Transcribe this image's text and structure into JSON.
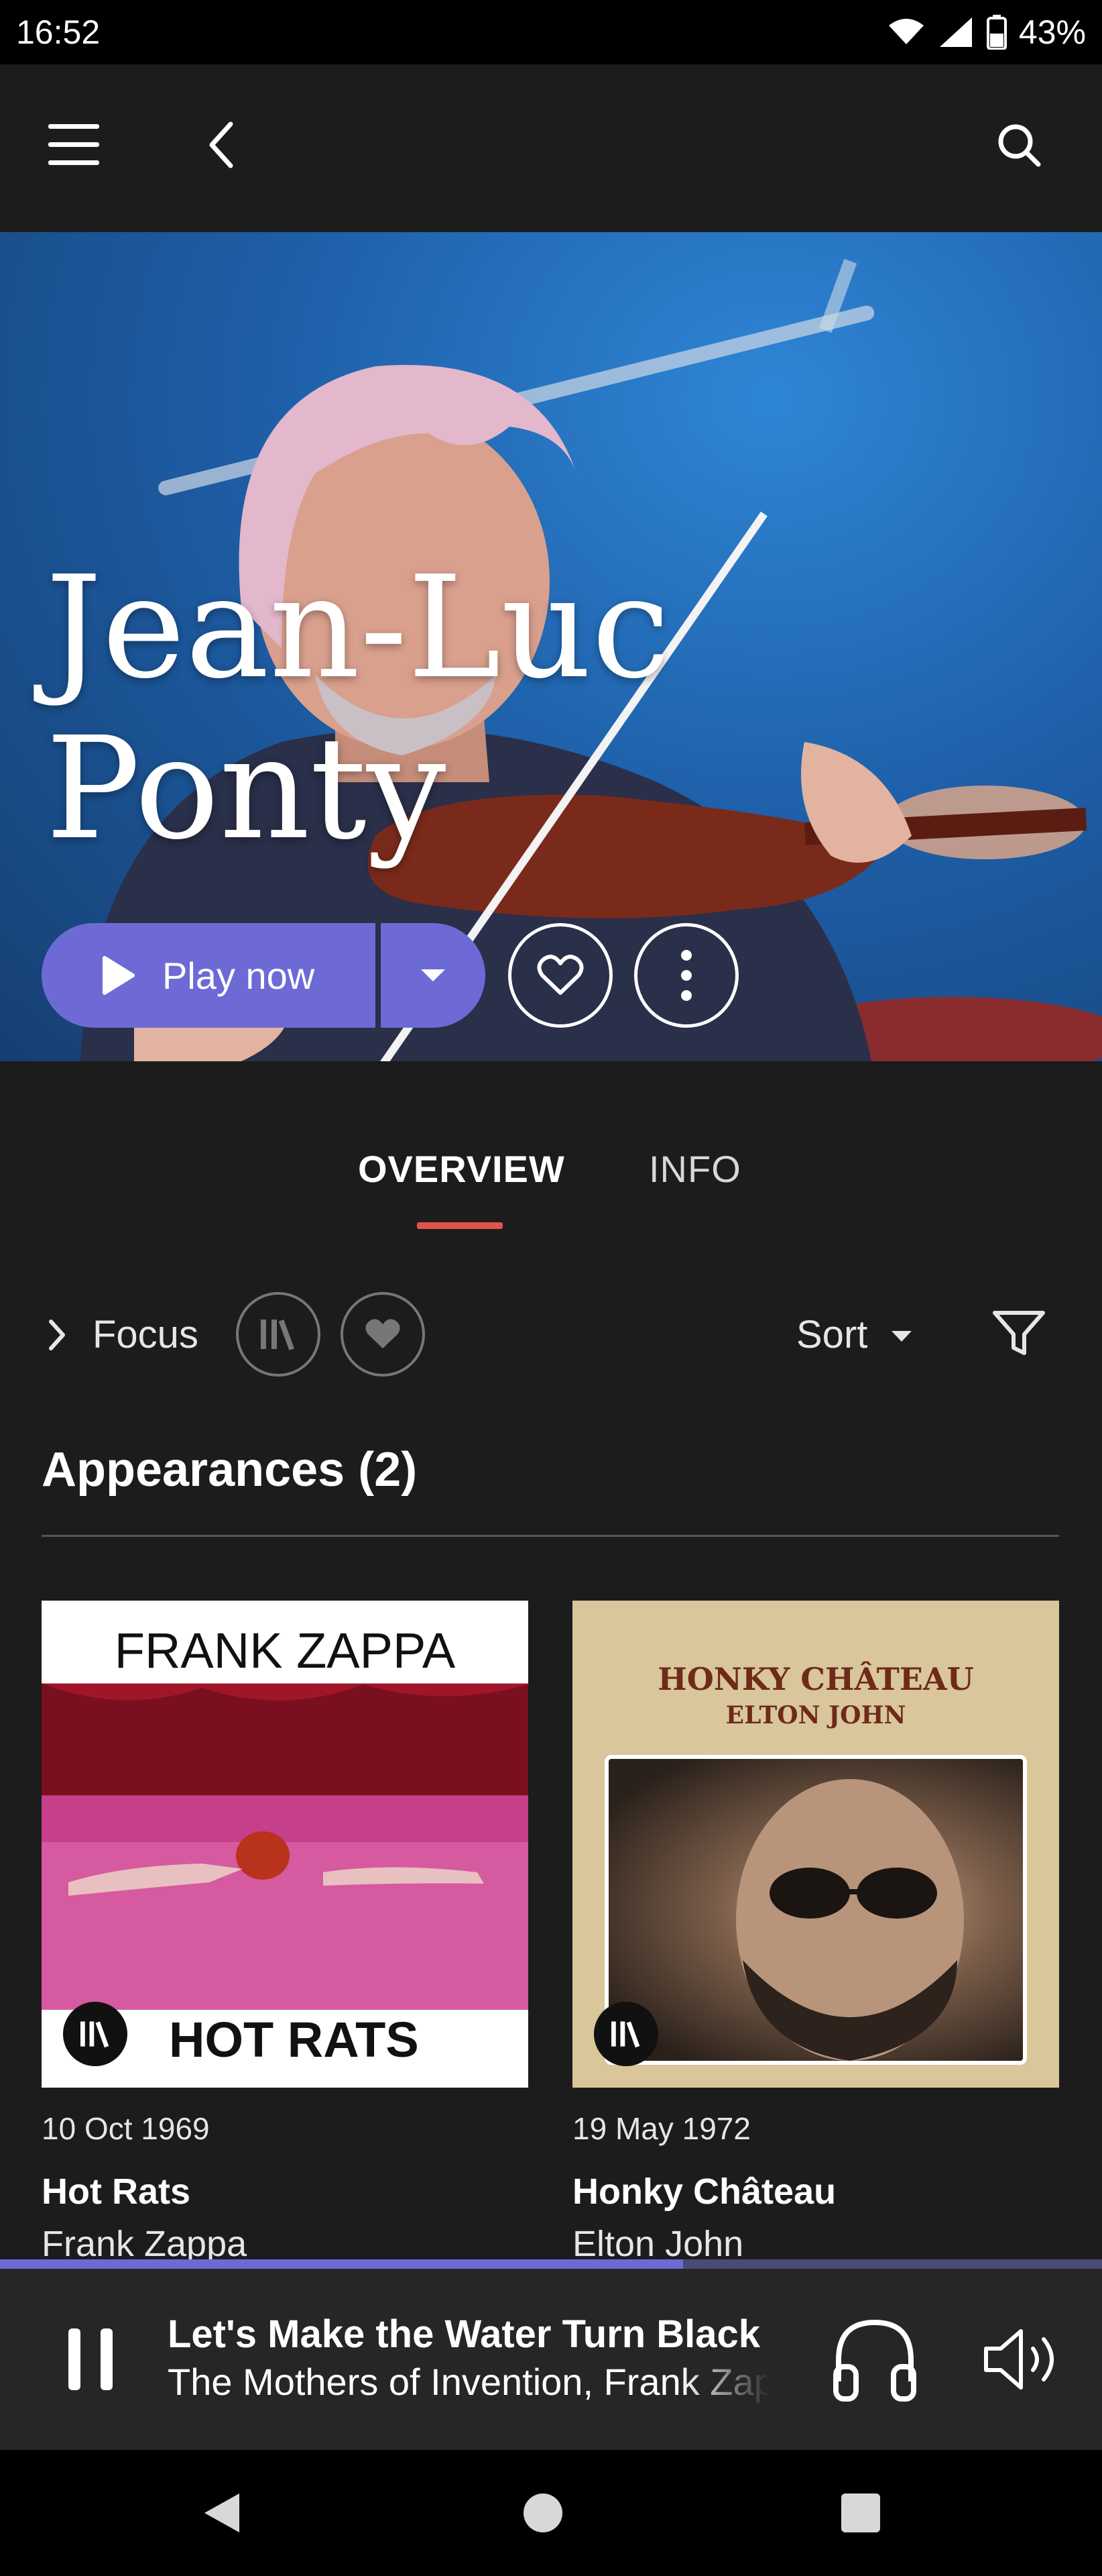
{
  "status_bar": {
    "time": "16:52",
    "battery": "43%",
    "icons": [
      "wifi-icon",
      "signal-icon",
      "battery-icon"
    ]
  },
  "app_bar": {
    "icons": [
      "menu-icon",
      "back-icon",
      "search-icon"
    ]
  },
  "artist": {
    "name": "Jean-Luc\nPonty"
  },
  "hero_actions": {
    "play_label": "Play now",
    "icons": [
      "play-icon",
      "dropdown-icon",
      "heart-icon",
      "more-icon"
    ]
  },
  "tabs": [
    {
      "label": "OVERVIEW",
      "active": true
    },
    {
      "label": "INFO",
      "active": false
    }
  ],
  "filters": {
    "focus_label": "Focus",
    "sort_label": "Sort",
    "icons": [
      "chevron-right-icon",
      "library-icon",
      "heart-icon",
      "caret-down-icon",
      "filter-icon"
    ]
  },
  "section": {
    "title": "Appearances (2)"
  },
  "albums": [
    {
      "cover_top_text": "FRANK ZAPPA",
      "cover_bottom_text": "HOT RATS",
      "date": "10 Oct 1969",
      "title": "Hot Rats",
      "artist": "Frank Zappa"
    },
    {
      "cover_title_line1": "HONKY CHÂTEAU",
      "cover_title_line2": "ELTON JOHN",
      "date": "19 May 1972",
      "title": "Honky Château",
      "artist": "Elton John"
    }
  ],
  "player": {
    "track_title": "Let's Make the Water Turn Black",
    "track_artists": "The Mothers of Invention, Frank Zappa",
    "progress": 0.62,
    "icons": [
      "pause-icon",
      "headphones-icon",
      "volume-icon"
    ]
  },
  "nav_bar": {
    "icons": [
      "nav-back-icon",
      "nav-home-icon",
      "nav-recents-icon"
    ]
  },
  "colors": {
    "accent": "#6d6ad6",
    "tab_indicator": "#e05548",
    "background": "#1c1c1c"
  }
}
